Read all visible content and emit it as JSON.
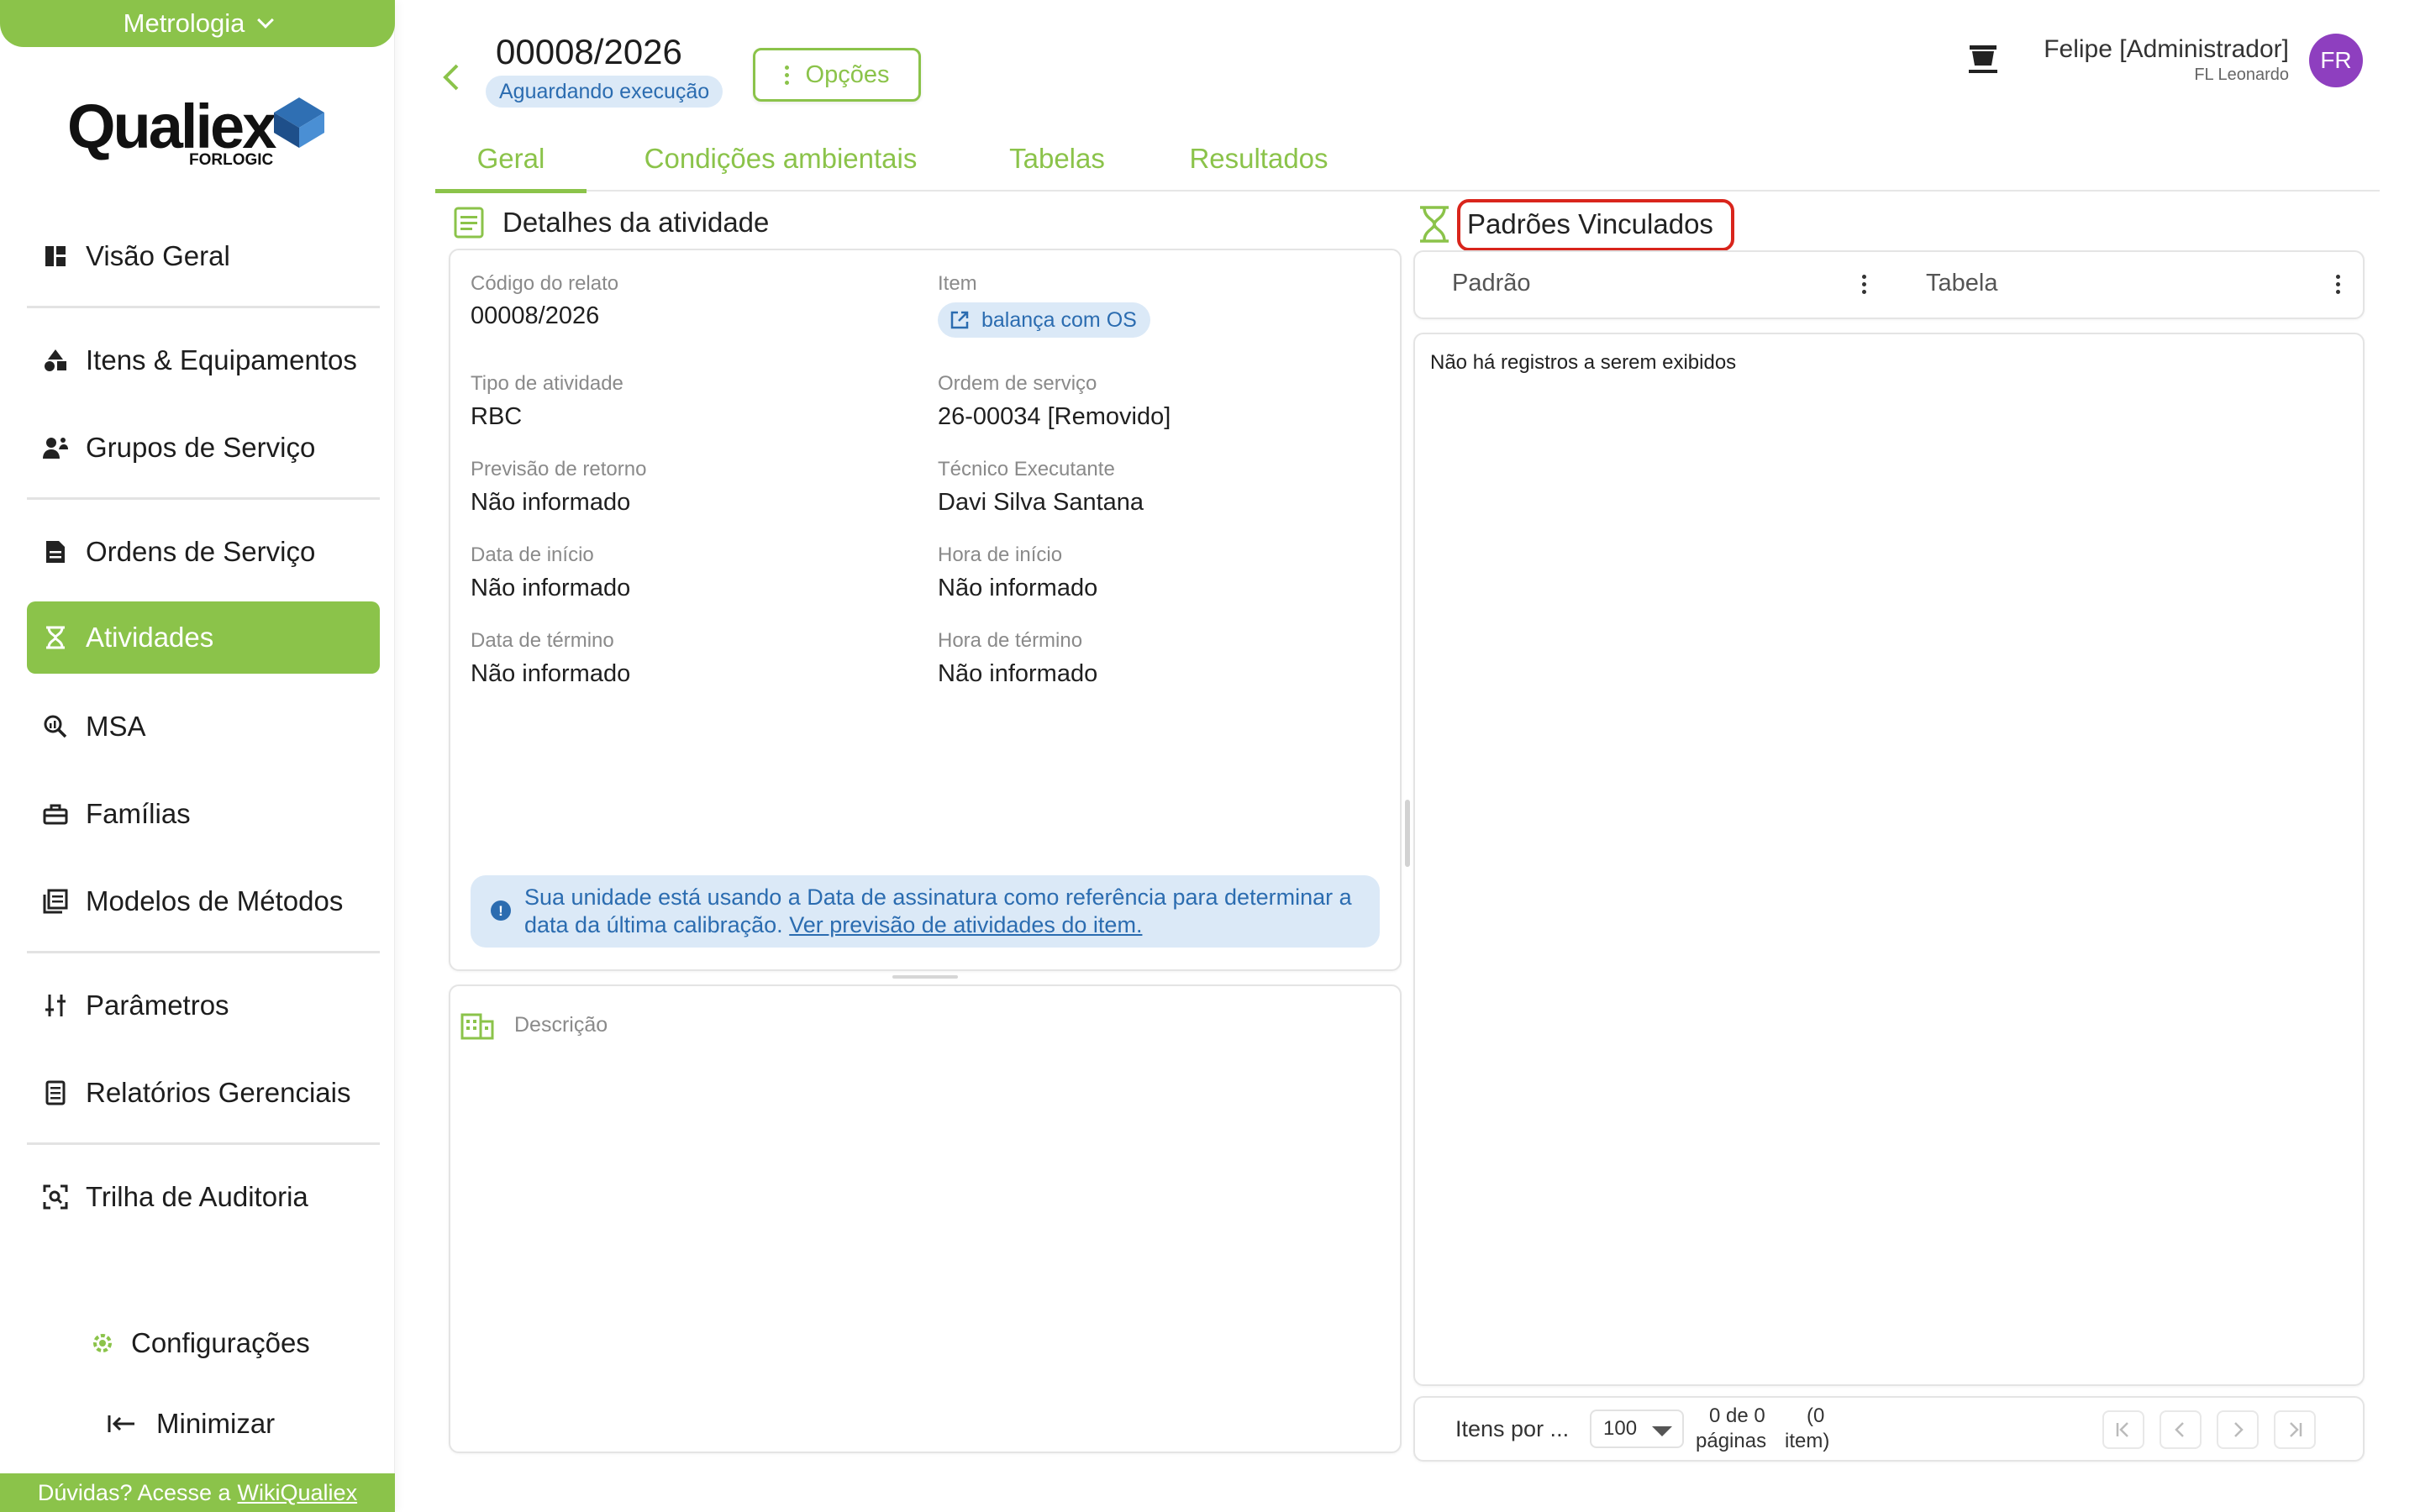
{
  "sidebar": {
    "module": "Metrologia",
    "logo_word": "Qualiex",
    "logo_sub": "FORLOGIC",
    "items": [
      {
        "label": "Visão Geral"
      },
      {
        "label": "Itens & Equipamentos"
      },
      {
        "label": "Grupos de Serviço"
      },
      {
        "label": "Ordens de Serviço"
      },
      {
        "label": "Atividades"
      },
      {
        "label": "MSA"
      },
      {
        "label": "Famílias"
      },
      {
        "label": "Modelos de Métodos"
      },
      {
        "label": "Parâmetros"
      },
      {
        "label": "Relatórios Gerenciais"
      },
      {
        "label": "Trilha de Auditoria"
      }
    ],
    "settings_label": "Configurações",
    "minimize_label": "Minimizar",
    "help_text": "Dúvidas? Acesse a",
    "help_link": "WikiQualiex"
  },
  "header": {
    "record_id": "00008/2026",
    "status": "Aguardando execução",
    "options_label": "Opções",
    "user_name": "Felipe [Administrador]",
    "user_unit": "FL Leonardo",
    "avatar_initials": "FR"
  },
  "tabs": [
    {
      "label": "Geral",
      "active": true
    },
    {
      "label": "Condições ambientais"
    },
    {
      "label": "Tabelas"
    },
    {
      "label": "Resultados"
    }
  ],
  "details": {
    "title": "Detalhes da atividade",
    "fields": {
      "codigo_label": "Código do relato",
      "codigo_value": "00008/2026",
      "item_label": "Item",
      "item_value": "balança com OS",
      "tipo_label": "Tipo de atividade",
      "tipo_value": "RBC",
      "ordem_label": "Ordem de serviço",
      "ordem_value": "26-00034 [Removido]",
      "previsao_label": "Previsão de retorno",
      "previsao_value": "Não informado",
      "tecnico_label": "Técnico Executante",
      "tecnico_value": "Davi Silva Santana",
      "data_inicio_label": "Data de início",
      "data_inicio_value": "Não informado",
      "hora_inicio_label": "Hora de início",
      "hora_inicio_value": "Não informado",
      "data_termino_label": "Data de término",
      "data_termino_value": "Não informado",
      "hora_termino_label": "Hora de término",
      "hora_termino_value": "Não informado"
    },
    "info_text": "Sua unidade está usando a Data de assinatura como referência para determinar a data da última calibração.",
    "info_link": "Ver previsão de atividades do item.",
    "description_placeholder": "Descrição"
  },
  "standards": {
    "title": "Padrões Vinculados",
    "columns": [
      "Padrão",
      "Tabela"
    ],
    "empty_message": "Não há registros a serem exibidos",
    "pager": {
      "items_per_page_label": "Itens por ...",
      "per_page_value": "100",
      "range_text": "0 de 0",
      "range_text2": "páginas",
      "count_text": "(0",
      "count_text2": "item)"
    }
  },
  "colors": {
    "accent": "#8bc34a",
    "info": "#2b6cb0",
    "info_bg": "#dbe9f7",
    "highlight": "#d9251c",
    "avatar": "#8e3fbf"
  }
}
